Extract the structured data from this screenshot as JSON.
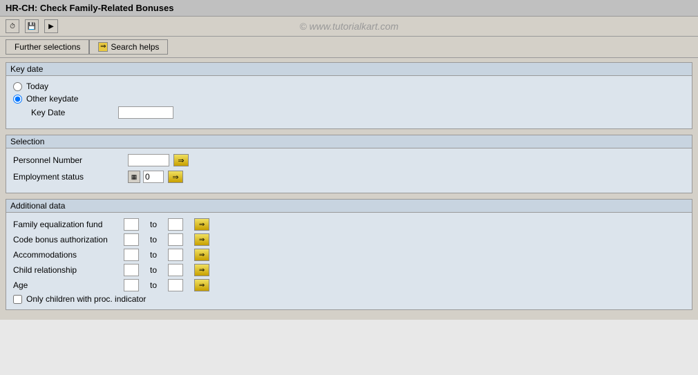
{
  "title": "HR-CH: Check Family-Related Bonuses",
  "watermark": "© www.tutorialkart.com",
  "toolbar": {
    "icons": [
      "clock-icon",
      "save-icon",
      "print-icon"
    ]
  },
  "tabs": [
    {
      "id": "further-selections",
      "label": "Further selections",
      "active": false
    },
    {
      "id": "search-helps",
      "label": "Search helps",
      "active": false
    }
  ],
  "key_date_section": {
    "title": "Key date",
    "today_label": "Today",
    "other_keydate_label": "Other keydate",
    "key_date_label": "Key Date",
    "selected": "other"
  },
  "selection_section": {
    "title": "Selection",
    "personnel_number_label": "Personnel Number",
    "employment_status_label": "Employment status",
    "employment_status_value": "0"
  },
  "additional_data_section": {
    "title": "Additional data",
    "rows": [
      {
        "label": "Family equalization fund",
        "to": "to"
      },
      {
        "label": "Code bonus authorization",
        "to": "to"
      },
      {
        "label": "Accommodations",
        "to": "to"
      },
      {
        "label": "Child relationship",
        "to": "to"
      },
      {
        "label": "Age",
        "to": "to"
      }
    ],
    "checkbox_label": "Only children with proc. indicator"
  }
}
